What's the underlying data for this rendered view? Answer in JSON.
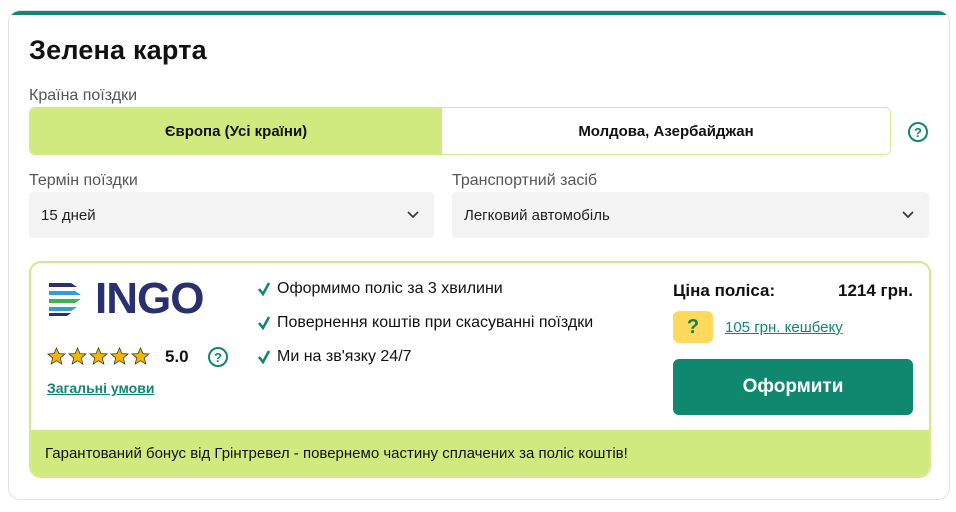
{
  "header": {
    "title": "Зелена карта"
  },
  "country": {
    "label": "Країна поїздки",
    "options": [
      {
        "label": "Європа (Усі країни)",
        "selected": true
      },
      {
        "label": "Молдова, Азербайджан",
        "selected": false
      }
    ],
    "help_icon": "question-icon"
  },
  "term": {
    "label": "Термін поїздки",
    "value": "15 дней"
  },
  "transport": {
    "label": "Транспортний засіб",
    "value": "Легковий автомобіль"
  },
  "offer": {
    "insurer": "INGO",
    "rating": "5.0",
    "rating_stars": 5,
    "terms_link": "Загальні умови",
    "features": [
      "Оформимо поліс за 3 хвилини",
      "Повернення коштів при скасуванні поїздки",
      "Ми на зв'язку 24/7"
    ],
    "price_label": "Ціна поліса:",
    "price_value": "1214 грн.",
    "cashback_link": "105 грн. кешбеку",
    "buy_button": "Оформити",
    "bonus_text": "Гарантований бонус від Грінтревел - повернемо частину сплачених за поліс коштів!"
  },
  "colors": {
    "accent": "#10886f",
    "lime": "#d1ea80",
    "star": "#f5b400",
    "cashback_bg": "#ffd95c",
    "logo": "#2a2f6e"
  }
}
